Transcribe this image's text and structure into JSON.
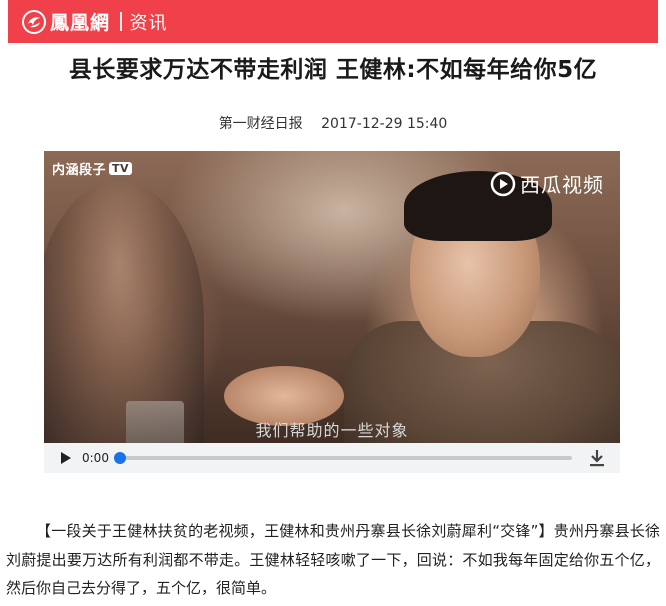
{
  "header": {
    "brand": "鳳凰網",
    "section": "资讯",
    "brand_color": "#f0404a"
  },
  "article": {
    "title": "县长要求万达不带走利润 王健林:不如每年给你5亿",
    "source": "第一财经日报",
    "datetime": "2017-12-29 15:40"
  },
  "video": {
    "watermark_left": "内涵段子",
    "watermark_left_badge": "TV",
    "watermark_right": "西瓜视频",
    "subtitle": "我们帮助的一些对象",
    "player": {
      "current_time": "0:00",
      "progress": 0,
      "accent_color": "#1a73e8",
      "play_icon": "play-icon",
      "download_icon": "download-icon"
    }
  },
  "body": {
    "paragraph": "【一段关于王健林扶贫的老视频，王健林和贵州丹寨县长徐刘蔚犀利“交锋”】贵州丹寨县长徐刘蔚提出要万达所有利润都不带走。王健林轻轻咳嗽了一下，回说：不如我每年固定给你五个亿，然后你自己去分得了，五个亿，很简单。"
  }
}
